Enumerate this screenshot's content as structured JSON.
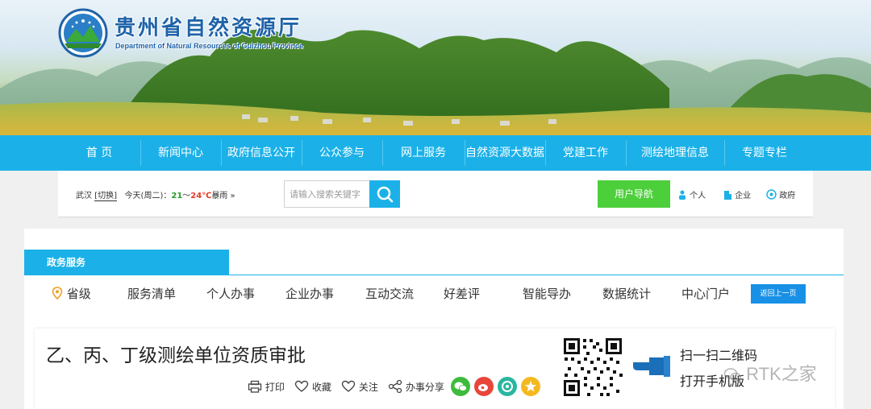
{
  "header": {
    "title": "贵州省自然资源厅",
    "subtitle": "Department of Natural Resources of Guizhou Province"
  },
  "nav": {
    "items": [
      "首  页",
      "新闻中心",
      "政府信息公开",
      "公众参与",
      "网上服务",
      "自然资源大数据",
      "党建工作",
      "测绘地理信息",
      "专题专栏"
    ]
  },
  "infobar": {
    "city": "武汉",
    "switch_label": "[切换]",
    "today_label": "今天(周二)：",
    "temp_low": "21",
    "temp_sep": "～",
    "temp_high": "24℃",
    "weather": "暴雨",
    "more": "»",
    "search_placeholder": "请输入搜索关键字",
    "user_nav_label": "用户导航",
    "user_links": [
      "个人",
      "企业",
      "政府"
    ]
  },
  "services": {
    "tab_label": "政务服务",
    "location_label": "省级",
    "items": [
      "服务清单",
      "个人办事",
      "企业办事",
      "互动交流",
      "好差评",
      "智能导办",
      "数据统计",
      "中心门户"
    ],
    "back_label": "返回上一页"
  },
  "detail": {
    "title": "乙、丙、丁级测绘单位资质审批",
    "print_label": "打印",
    "favorite_label": "收藏",
    "follow_label": "关注",
    "share_label": "办事分享",
    "qr_line1": "扫一扫二维码",
    "qr_line2": "打开手机版"
  },
  "watermark": "RTK之家",
  "colors": {
    "accent": "#1bb1e8",
    "green_button": "#4ccf3a",
    "back_button": "#1890e6",
    "share_wechat": "#3dbb3d",
    "share_weibo": "#e8463b",
    "share_qzone": "#2ab6a0",
    "share_fav": "#f5b920"
  }
}
